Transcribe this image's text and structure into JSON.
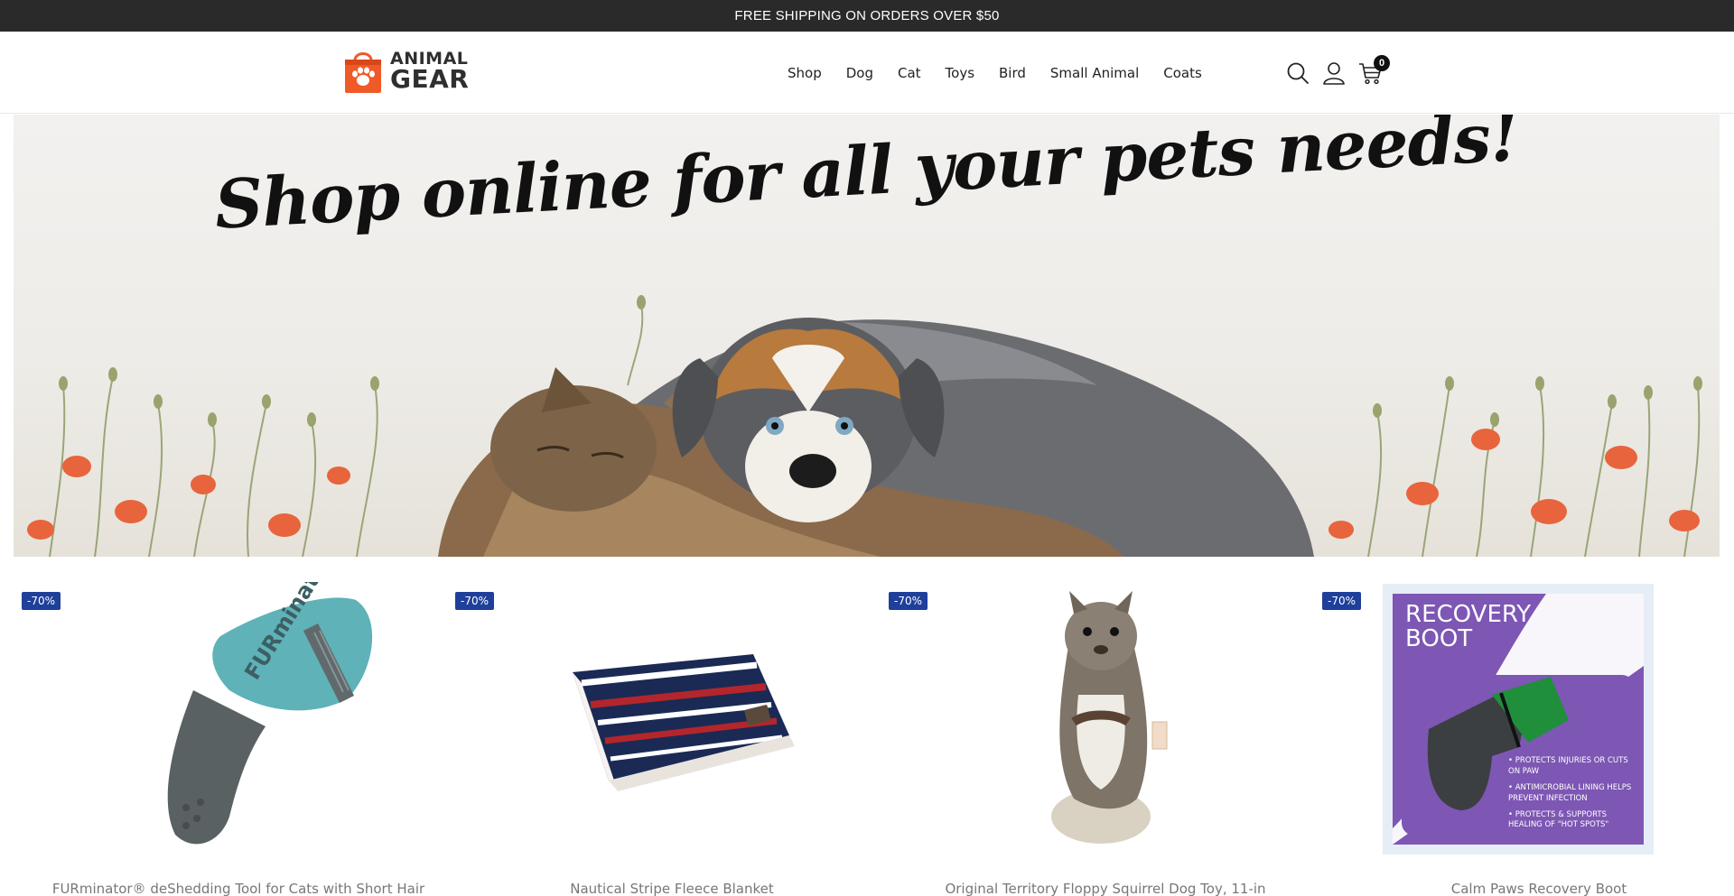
{
  "announcement": {
    "text": "FREE SHIPPING ON ORDERS OVER $50"
  },
  "logo": {
    "line1": "ANIMAL",
    "line2": "GEAR"
  },
  "nav": {
    "items": [
      "Shop",
      "Dog",
      "Cat",
      "Toys",
      "Bird",
      "Small Animal",
      "Coats"
    ]
  },
  "header_icons": {
    "search": "search-icon",
    "account": "user-icon",
    "cart": "cart-icon",
    "cart_count": "0"
  },
  "hero": {
    "headline": "Shop online for all your pets needs!"
  },
  "products": [
    {
      "badge": "-70%",
      "title": "FURminator® deShedding Tool for Cats with Short Hair",
      "brand_mark": "FURminator"
    },
    {
      "badge": "-70%",
      "title": "Nautical Stripe Fleece Blanket"
    },
    {
      "badge": "-70%",
      "title": "Original Territory Floppy Squirrel Dog Toy, 11-in"
    },
    {
      "badge": "-70%",
      "title": "Calm Paws Recovery Boot",
      "box_title_1": "RECOVERY",
      "box_title_2": "BOOT",
      "bullets": [
        "• PROTECTS INJURIES OR CUTS ON PAW",
        "• ANTIMICROBIAL LINING HELPS PREVENT INFECTION",
        "• PROTECTS & SUPPORTS HEALING OF \"HOT SPOTS\""
      ]
    }
  ],
  "colors": {
    "topbar": "#2a2a2a",
    "badge": "#1e3f9a",
    "logo_orange": "#f05a28",
    "recovery_purple": "#7d57b3"
  }
}
